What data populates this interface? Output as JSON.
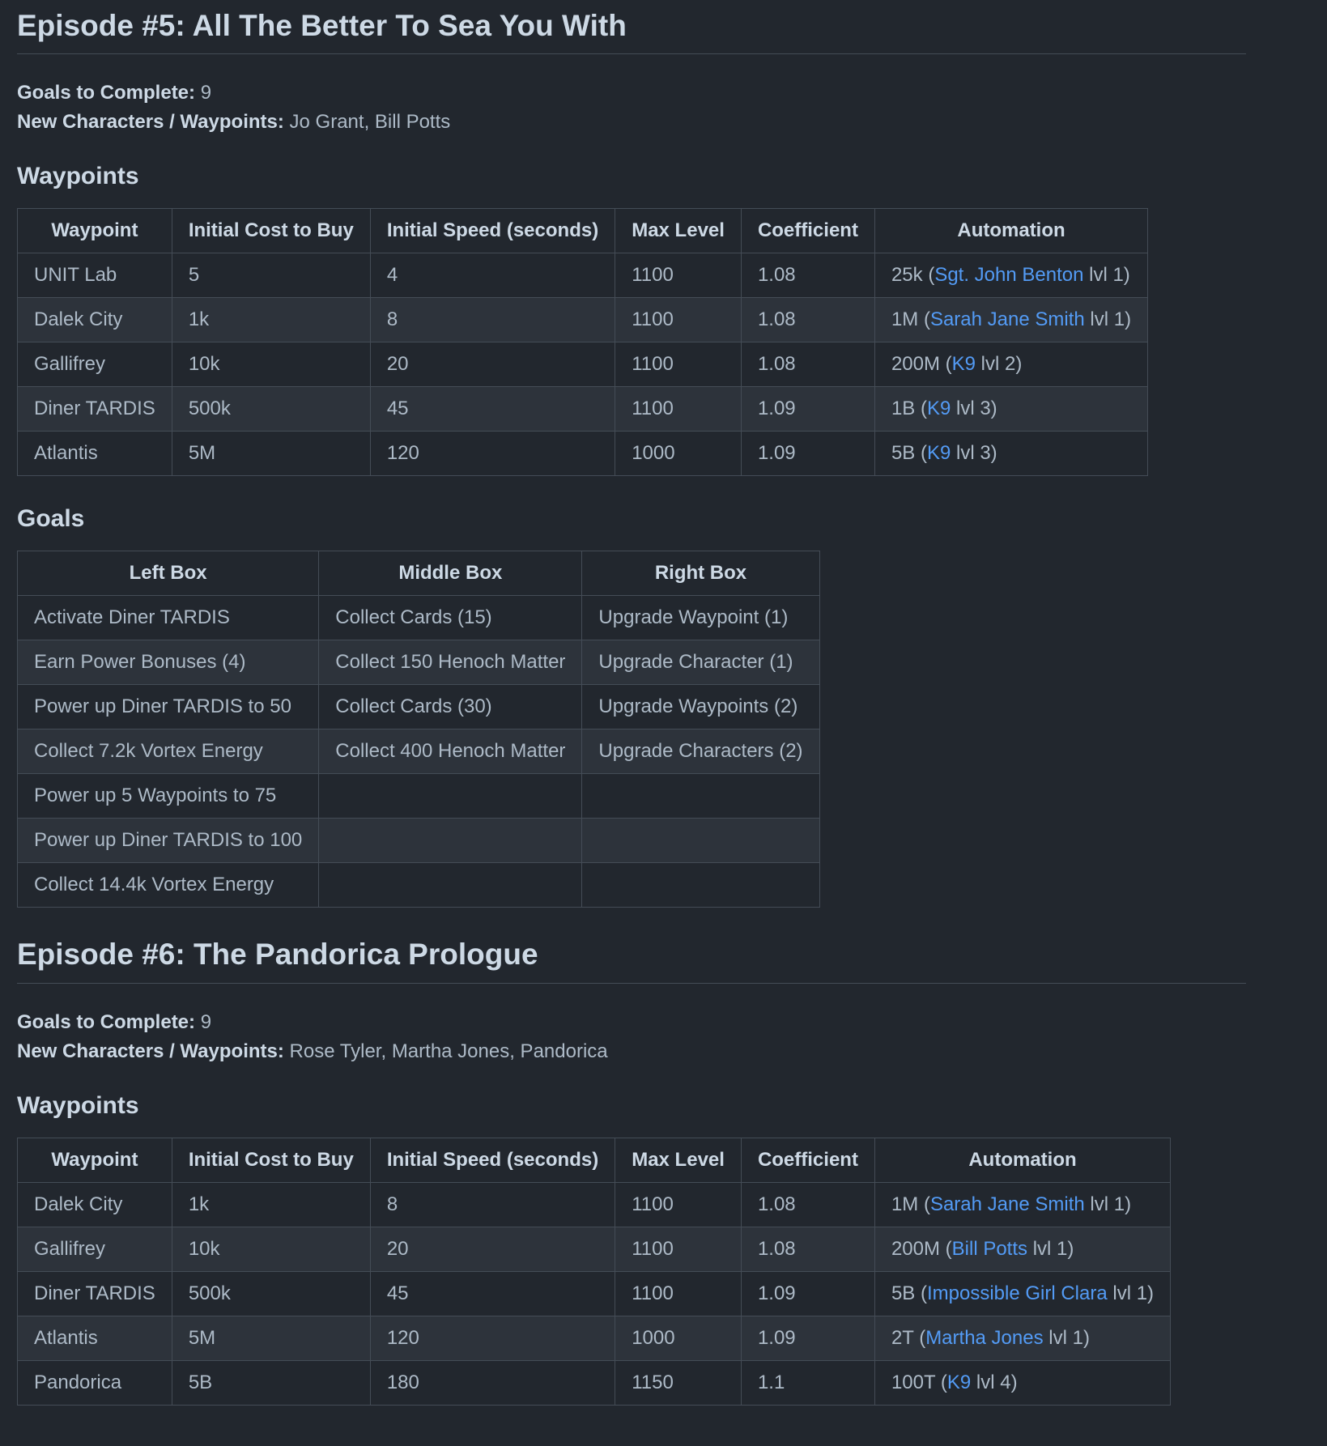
{
  "episodes": [
    {
      "title": "Episode #5: All The Better To Sea You With",
      "goals_label": "Goals to Complete:",
      "goals_value": "9",
      "new_label": "New Characters / Waypoints:",
      "new_value": "Jo Grant, Bill Potts",
      "waypoints_heading": "Waypoints",
      "waypoint_headers": [
        "Waypoint",
        "Initial Cost to Buy",
        "Initial Speed (seconds)",
        "Max Level",
        "Coefficient",
        "Automation"
      ],
      "waypoints": [
        {
          "name": "UNIT Lab",
          "cost": "5",
          "speed": "4",
          "max": "1100",
          "coef": "1.08",
          "auto_pre": "25k (",
          "auto_link": "Sgt. John Benton",
          "auto_post": " lvl 1)"
        },
        {
          "name": "Dalek City",
          "cost": "1k",
          "speed": "8",
          "max": "1100",
          "coef": "1.08",
          "auto_pre": "1M (",
          "auto_link": "Sarah Jane Smith",
          "auto_post": " lvl 1)"
        },
        {
          "name": "Gallifrey",
          "cost": "10k",
          "speed": "20",
          "max": "1100",
          "coef": "1.08",
          "auto_pre": "200M (",
          "auto_link": "K9",
          "auto_post": " lvl 2)"
        },
        {
          "name": "Diner TARDIS",
          "cost": "500k",
          "speed": "45",
          "max": "1100",
          "coef": "1.09",
          "auto_pre": "1B (",
          "auto_link": "K9",
          "auto_post": " lvl 3)"
        },
        {
          "name": "Atlantis",
          "cost": "5M",
          "speed": "120",
          "max": "1000",
          "coef": "1.09",
          "auto_pre": "5B (",
          "auto_link": "K9",
          "auto_post": " lvl 3)"
        }
      ],
      "goals_heading": "Goals",
      "goal_headers": [
        "Left Box",
        "Middle Box",
        "Right Box"
      ],
      "goals": [
        [
          "Activate Diner TARDIS",
          "Collect Cards (15)",
          "Upgrade Waypoint (1)"
        ],
        [
          "Earn Power Bonuses (4)",
          "Collect 150 Henoch Matter",
          "Upgrade Character (1)"
        ],
        [
          "Power up Diner TARDIS to 50",
          "Collect Cards (30)",
          "Upgrade Waypoints (2)"
        ],
        [
          "Collect 7.2k Vortex Energy",
          "Collect 400 Henoch Matter",
          "Upgrade Characters (2)"
        ],
        [
          "Power up 5 Waypoints to 75",
          "",
          ""
        ],
        [
          "Power up Diner TARDIS to 100",
          "",
          ""
        ],
        [
          "Collect 14.4k Vortex Energy",
          "",
          ""
        ]
      ]
    },
    {
      "title": "Episode #6: The Pandorica Prologue",
      "goals_label": "Goals to Complete:",
      "goals_value": "9",
      "new_label": "New Characters / Waypoints:",
      "new_value": "Rose Tyler, Martha Jones, Pandorica",
      "waypoints_heading": "Waypoints",
      "waypoint_headers": [
        "Waypoint",
        "Initial Cost to Buy",
        "Initial Speed (seconds)",
        "Max Level",
        "Coefficient",
        "Automation"
      ],
      "waypoints": [
        {
          "name": "Dalek City",
          "cost": "1k",
          "speed": "8",
          "max": "1100",
          "coef": "1.08",
          "auto_pre": "1M (",
          "auto_link": "Sarah Jane Smith",
          "auto_post": " lvl 1)"
        },
        {
          "name": "Gallifrey",
          "cost": "10k",
          "speed": "20",
          "max": "1100",
          "coef": "1.08",
          "auto_pre": "200M (",
          "auto_link": "Bill Potts",
          "auto_post": " lvl 1)"
        },
        {
          "name": "Diner TARDIS",
          "cost": "500k",
          "speed": "45",
          "max": "1100",
          "coef": "1.09",
          "auto_pre": "5B (",
          "auto_link": "Impossible Girl Clara",
          "auto_post": " lvl 1)"
        },
        {
          "name": "Atlantis",
          "cost": "5M",
          "speed": "120",
          "max": "1000",
          "coef": "1.09",
          "auto_pre": "2T (",
          "auto_link": "Martha Jones",
          "auto_post": " lvl 1)"
        },
        {
          "name": "Pandorica",
          "cost": "5B",
          "speed": "180",
          "max": "1150",
          "coef": "1.1",
          "auto_pre": "100T (",
          "auto_link": "K9",
          "auto_post": " lvl 4)"
        }
      ]
    }
  ],
  "colors": {
    "background": "#22272e",
    "row_alt": "#2d333b",
    "border": "#444c56",
    "link": "#539bf5",
    "text": "#adbac7",
    "heading": "#cdd9e5"
  }
}
